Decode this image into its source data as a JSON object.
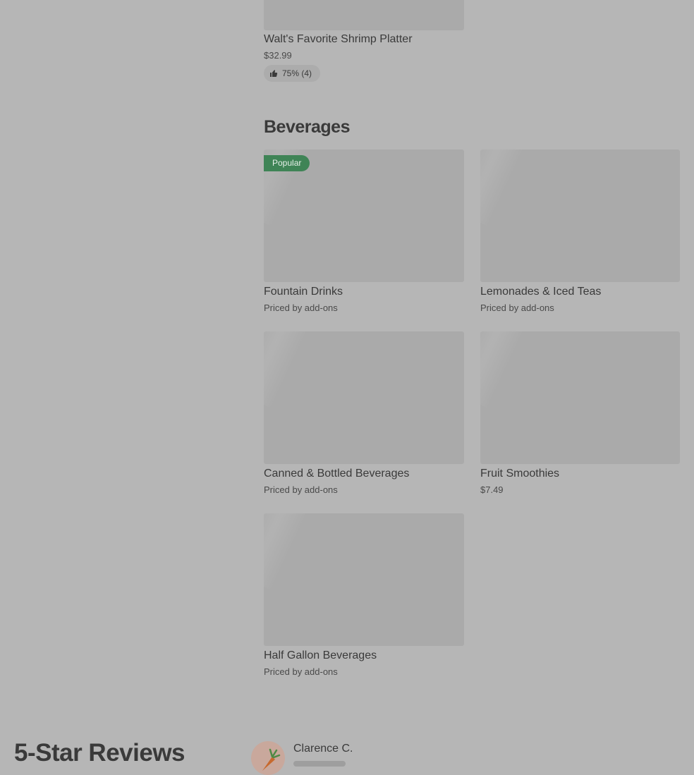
{
  "prev_item": {
    "title": "Walt's Favorite Shrimp Platter",
    "price": "$32.99",
    "rating": "75% (4)"
  },
  "beverages": {
    "heading": "Beverages",
    "items": [
      {
        "title": "Fountain Drinks",
        "price": "Priced by add-ons",
        "badge": "Popular"
      },
      {
        "title": "Lemonades & Iced Teas",
        "price": "Priced by add-ons"
      },
      {
        "title": "Canned & Bottled Beverages",
        "price": "Priced by add-ons"
      },
      {
        "title": "Fruit Smoothies",
        "price": "$7.49"
      },
      {
        "title": "Half Gallon Beverages",
        "price": "Priced by add-ons"
      }
    ]
  },
  "reviews": {
    "heading": "5-Star Reviews",
    "first_reviewer": {
      "name": "Clarence C.",
      "avatar_icon": "carrot-icon"
    }
  },
  "colors": {
    "background": "#b6b6b6",
    "placeholder": "#aaaaaa",
    "popular_badge": "#3f8456",
    "text": "#3a3a3a"
  }
}
